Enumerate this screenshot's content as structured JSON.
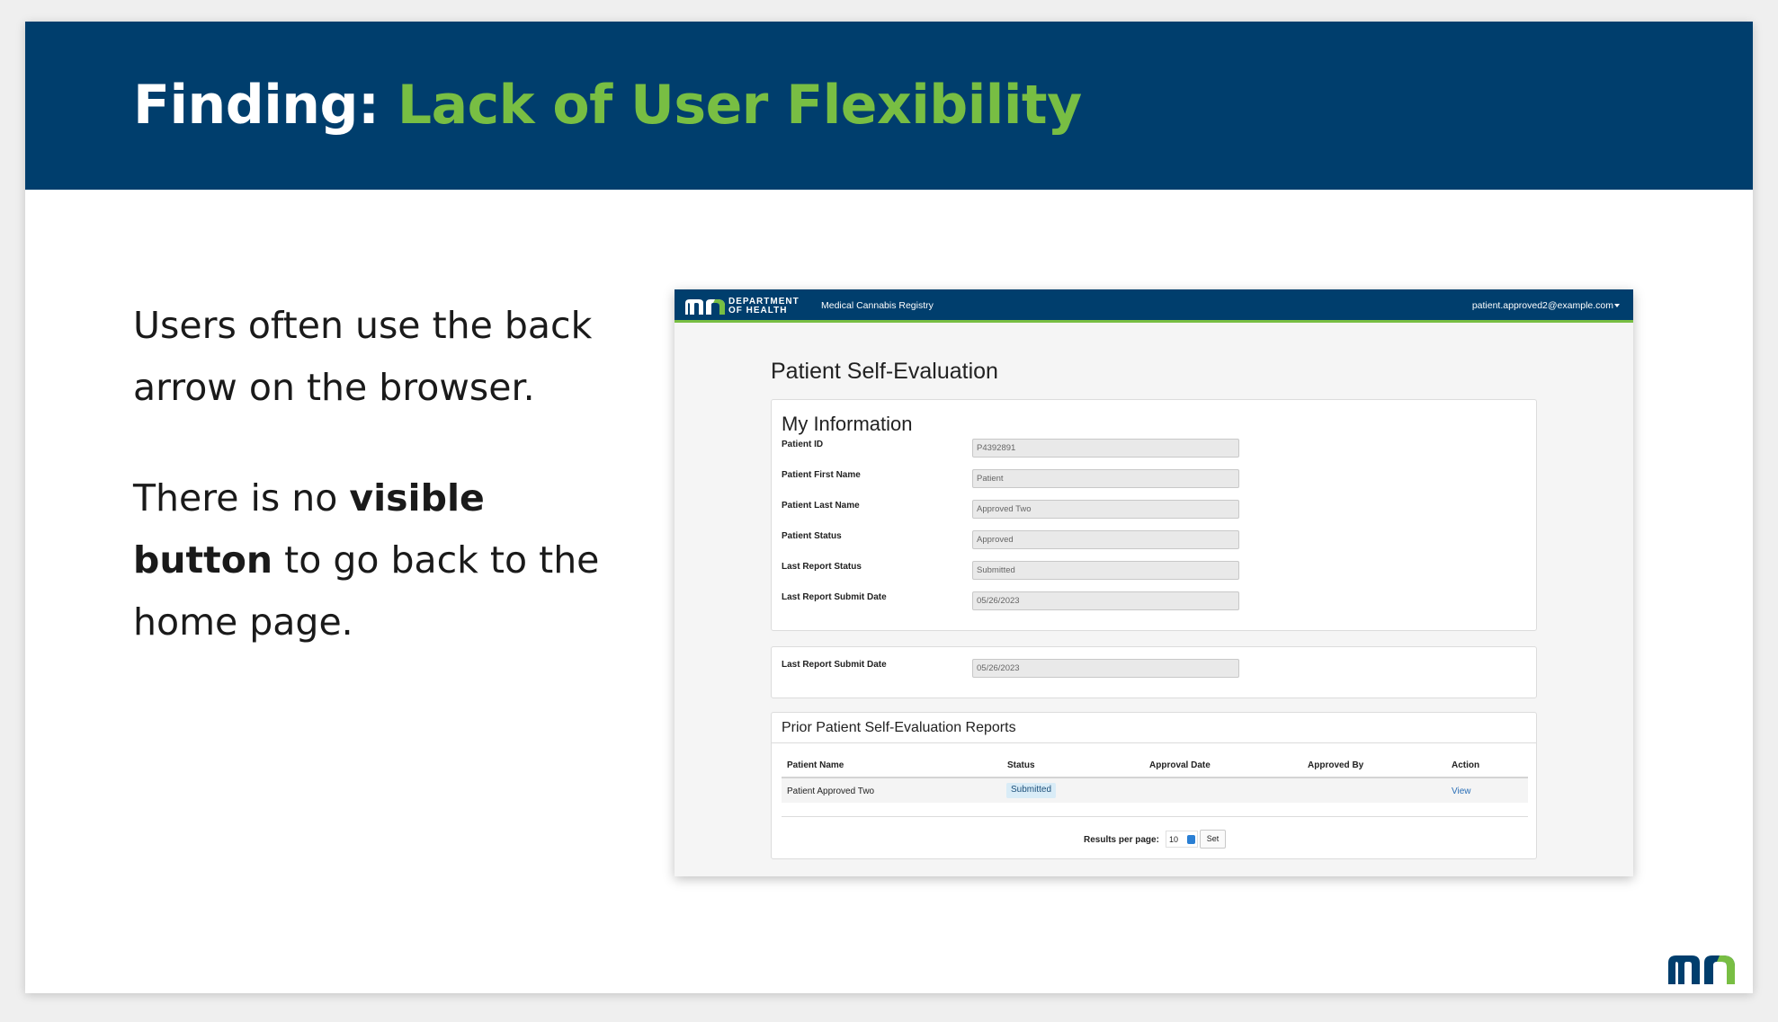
{
  "slide": {
    "title_prefix": "Finding:",
    "title_accent": "Lack of User Flexibility",
    "para1": "Users often use the back arrow on the browser.",
    "para2_before": "There is no ",
    "para2_bold": "visible button",
    "para2_after": " to go back to the home page."
  },
  "app": {
    "dept_line1": "DEPARTMENT",
    "dept_line2": "OF HEALTH",
    "app_name": "Medical Cannabis Registry",
    "user_email": "patient.approved2@example.com",
    "page_title": "Patient Self-Evaluation",
    "my_info": {
      "heading": "My Information",
      "fields": [
        {
          "label": "Patient ID",
          "value": "P4392891"
        },
        {
          "label": "Patient First Name",
          "value": "Patient"
        },
        {
          "label": "Patient Last Name",
          "value": "Approved Two"
        },
        {
          "label": "Patient Status",
          "value": "Approved"
        },
        {
          "label": "Last Report Status",
          "value": "Submitted"
        },
        {
          "label": "Last Report Submit Date",
          "value": "05/26/2023"
        }
      ]
    },
    "summary": {
      "label": "Last Report Submit Date",
      "value": "05/26/2023"
    },
    "reports": {
      "heading": "Prior Patient Self-Evaluation Reports",
      "columns": [
        "Patient Name",
        "Status",
        "Approval Date",
        "Approved By",
        "Action"
      ],
      "rows": [
        {
          "patient_name": "Patient Approved Two",
          "status": "Submitted",
          "approval_date": "",
          "approved_by": "",
          "action": "View"
        }
      ],
      "results_per_page_label": "Results per page:",
      "results_per_page_value": "10",
      "set_label": "Set"
    }
  },
  "colors": {
    "banner": "#003e6d",
    "accent_green": "#78be43",
    "link": "#2a6fb7"
  },
  "icons": {
    "mn_logo": "mn-logo-icon",
    "caret": "caret-down-icon",
    "select_arrow": "select-arrow-icon"
  }
}
